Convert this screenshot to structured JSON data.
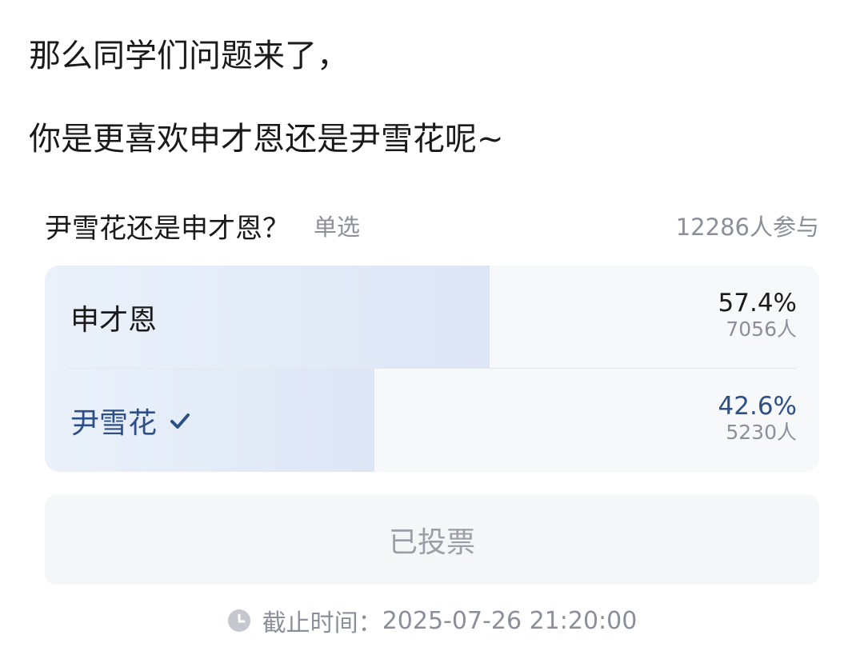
{
  "post": {
    "line1": "那么同学们问题来了，",
    "line2": "你是更喜欢申才恩还是尹雪花呢~"
  },
  "poll": {
    "title": "尹雪花还是申才恩？",
    "type": "单选",
    "participants": "12286人参与",
    "accent_color": "#2d4f86",
    "options": [
      {
        "label": "申才恩",
        "percent_text": "57.4%",
        "votes_text": "7056人",
        "percent": 57.4,
        "selected": false
      },
      {
        "label": "尹雪花",
        "percent_text": "42.6%",
        "votes_text": "5230人",
        "percent": 42.6,
        "selected": true,
        "selected_icon": "check-icon"
      }
    ],
    "button_label": "已投票",
    "deadline": {
      "icon": "clock-icon",
      "label": "截止时间：",
      "value": "2025-07-26 21:20:00"
    }
  }
}
